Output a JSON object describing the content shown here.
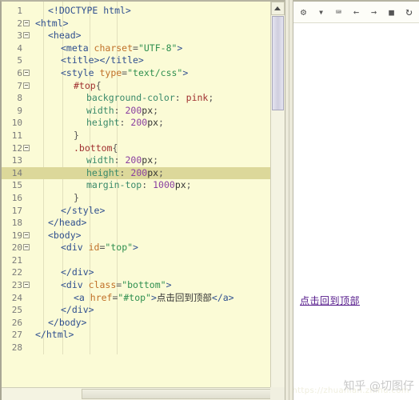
{
  "editor": {
    "highlighted_line": 14,
    "lines": [
      {
        "num": "1",
        "fold": false,
        "indent": 1,
        "tokens": [
          {
            "t": "tag",
            "v": "<!DOCTYPE html>"
          }
        ]
      },
      {
        "num": "2",
        "fold": true,
        "indent": 0,
        "tokens": [
          {
            "t": "tag",
            "v": "<html>"
          }
        ]
      },
      {
        "num": "3",
        "fold": true,
        "indent": 1,
        "tokens": [
          {
            "t": "tag",
            "v": "<head>"
          }
        ]
      },
      {
        "num": "4",
        "fold": false,
        "indent": 2,
        "tokens": [
          {
            "t": "tag",
            "v": "<meta "
          },
          {
            "t": "attr",
            "v": "charset"
          },
          {
            "t": "punc",
            "v": "="
          },
          {
            "t": "str",
            "v": "\"UTF-8\""
          },
          {
            "t": "tag",
            "v": ">"
          }
        ]
      },
      {
        "num": "5",
        "fold": false,
        "indent": 2,
        "tokens": [
          {
            "t": "tag",
            "v": "<title></title>"
          }
        ]
      },
      {
        "num": "6",
        "fold": true,
        "indent": 2,
        "tokens": [
          {
            "t": "tag",
            "v": "<style "
          },
          {
            "t": "attr",
            "v": "type"
          },
          {
            "t": "punc",
            "v": "="
          },
          {
            "t": "str",
            "v": "\"text/css\""
          },
          {
            "t": "tag",
            "v": ">"
          }
        ]
      },
      {
        "num": "7",
        "fold": true,
        "indent": 3,
        "tokens": [
          {
            "t": "sel",
            "v": "#top"
          },
          {
            "t": "punc",
            "v": "{"
          }
        ]
      },
      {
        "num": "8",
        "fold": false,
        "indent": 4,
        "tokens": [
          {
            "t": "prop",
            "v": "background-color"
          },
          {
            "t": "punc",
            "v": ": "
          },
          {
            "t": "val",
            "v": "pink"
          },
          {
            "t": "punc",
            "v": ";"
          }
        ]
      },
      {
        "num": "9",
        "fold": false,
        "indent": 4,
        "tokens": [
          {
            "t": "prop",
            "v": "width"
          },
          {
            "t": "punc",
            "v": ": "
          },
          {
            "t": "num",
            "v": "200"
          },
          {
            "t": "plain",
            "v": "px"
          },
          {
            "t": "punc",
            "v": ";"
          }
        ]
      },
      {
        "num": "10",
        "fold": false,
        "indent": 4,
        "tokens": [
          {
            "t": "prop",
            "v": "height"
          },
          {
            "t": "punc",
            "v": ": "
          },
          {
            "t": "num",
            "v": "200"
          },
          {
            "t": "plain",
            "v": "px"
          },
          {
            "t": "punc",
            "v": ";"
          }
        ]
      },
      {
        "num": "11",
        "fold": false,
        "indent": 3,
        "tokens": [
          {
            "t": "punc",
            "v": "}"
          }
        ]
      },
      {
        "num": "12",
        "fold": true,
        "indent": 3,
        "tokens": [
          {
            "t": "sel",
            "v": ".bottom"
          },
          {
            "t": "punc",
            "v": "{"
          }
        ]
      },
      {
        "num": "13",
        "fold": false,
        "indent": 4,
        "tokens": [
          {
            "t": "prop",
            "v": "width"
          },
          {
            "t": "punc",
            "v": ": "
          },
          {
            "t": "num",
            "v": "200"
          },
          {
            "t": "plain",
            "v": "px"
          },
          {
            "t": "punc",
            "v": ";"
          }
        ]
      },
      {
        "num": "14",
        "fold": false,
        "indent": 4,
        "tokens": [
          {
            "t": "prop",
            "v": "height"
          },
          {
            "t": "punc",
            "v": ": "
          },
          {
            "t": "num",
            "v": "200"
          },
          {
            "t": "plain",
            "v": "px"
          },
          {
            "t": "punc",
            "v": ";"
          }
        ]
      },
      {
        "num": "15",
        "fold": false,
        "indent": 4,
        "tokens": [
          {
            "t": "prop",
            "v": "margin-top"
          },
          {
            "t": "punc",
            "v": ": "
          },
          {
            "t": "num",
            "v": "1000"
          },
          {
            "t": "plain",
            "v": "px"
          },
          {
            "t": "punc",
            "v": ";"
          }
        ]
      },
      {
        "num": "16",
        "fold": false,
        "indent": 3,
        "tokens": [
          {
            "t": "punc",
            "v": "}"
          }
        ]
      },
      {
        "num": "17",
        "fold": false,
        "indent": 2,
        "tokens": [
          {
            "t": "tag",
            "v": "</style>"
          }
        ]
      },
      {
        "num": "18",
        "fold": false,
        "indent": 1,
        "tokens": [
          {
            "t": "tag",
            "v": "</head>"
          }
        ]
      },
      {
        "num": "19",
        "fold": true,
        "indent": 1,
        "tokens": [
          {
            "t": "tag",
            "v": "<body>"
          }
        ]
      },
      {
        "num": "20",
        "fold": true,
        "indent": 2,
        "tokens": [
          {
            "t": "tag",
            "v": "<div "
          },
          {
            "t": "attr",
            "v": "id"
          },
          {
            "t": "punc",
            "v": "="
          },
          {
            "t": "str",
            "v": "\"top\""
          },
          {
            "t": "tag",
            "v": ">"
          }
        ]
      },
      {
        "num": "21",
        "fold": false,
        "indent": 0,
        "tokens": []
      },
      {
        "num": "22",
        "fold": false,
        "indent": 2,
        "tokens": [
          {
            "t": "tag",
            "v": "</div>"
          }
        ]
      },
      {
        "num": "23",
        "fold": true,
        "indent": 2,
        "tokens": [
          {
            "t": "tag",
            "v": "<div "
          },
          {
            "t": "attr",
            "v": "class"
          },
          {
            "t": "punc",
            "v": "="
          },
          {
            "t": "str",
            "v": "\"bottom\""
          },
          {
            "t": "tag",
            "v": ">"
          }
        ]
      },
      {
        "num": "24",
        "fold": false,
        "indent": 3,
        "tokens": [
          {
            "t": "tag",
            "v": "<a "
          },
          {
            "t": "attr",
            "v": "href"
          },
          {
            "t": "punc",
            "v": "="
          },
          {
            "t": "str",
            "v": "\"#top\""
          },
          {
            "t": "tag",
            "v": ">"
          },
          {
            "t": "cn",
            "v": "点击回到顶部"
          },
          {
            "t": "tag",
            "v": "</a>"
          }
        ]
      },
      {
        "num": "25",
        "fold": false,
        "indent": 2,
        "tokens": [
          {
            "t": "tag",
            "v": "</div>"
          }
        ]
      },
      {
        "num": "26",
        "fold": false,
        "indent": 1,
        "tokens": [
          {
            "t": "tag",
            "v": "</body>"
          }
        ]
      },
      {
        "num": "27",
        "fold": false,
        "indent": 0,
        "tokens": [
          {
            "t": "tag",
            "v": "</html>"
          }
        ]
      },
      {
        "num": "28",
        "fold": false,
        "indent": 0,
        "tokens": []
      }
    ]
  },
  "preview": {
    "toolbar": [
      {
        "name": "gear-icon",
        "glyph": "⚙"
      },
      {
        "name": "chevron-down-icon",
        "glyph": "▼"
      },
      {
        "name": "console-icon",
        "glyph": "⌨"
      },
      {
        "name": "back-arrow-icon",
        "glyph": "←"
      },
      {
        "name": "forward-arrow-icon",
        "glyph": "→"
      },
      {
        "name": "stop-icon",
        "glyph": "■"
      },
      {
        "name": "refresh-icon",
        "glyph": "↻"
      }
    ],
    "link_text": "点击回到顶部",
    "watermark": "知乎 @切图仔",
    "url_watermark": "https://zhuanlan.zhihu.com"
  },
  "colors": {
    "editor_bg": "#fbfbd6",
    "highlight_line": "#dcd89a",
    "tag": "#2f4f8f",
    "attr": "#c07028",
    "string": "#2f8f4f",
    "css_prop": "#3a8a6a",
    "css_value": "#a03030",
    "number": "#8a3fa0",
    "link": "#551a8b",
    "chrome": "#eceadb"
  }
}
